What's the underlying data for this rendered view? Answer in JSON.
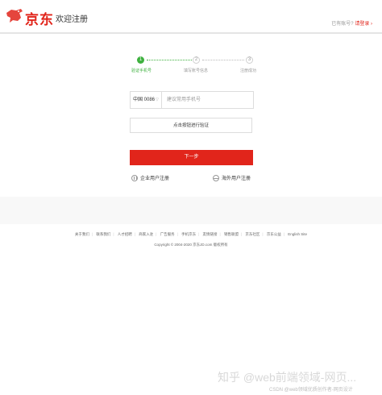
{
  "header": {
    "logo_text": "京东",
    "page_title": "欢迎注册",
    "login_hint": "已有账号?",
    "login_link": "请登录",
    "login_arrow": "›"
  },
  "steps": [
    {
      "number": "1",
      "label": "验证手机号",
      "state": "active"
    },
    {
      "number": "2",
      "label": "填写账号信息",
      "state": "todo"
    },
    {
      "number": "3",
      "label": "注册成功",
      "state": "todo"
    }
  ],
  "form": {
    "country_code": "中国 0086",
    "country_arrow": "▽",
    "phone_placeholder": "建议常用手机号",
    "verify_label": "点击按钮进行验证",
    "next_label": "下一步",
    "enterprise_link": "企业用户注册",
    "overseas_link": "海外用户注册"
  },
  "footer": {
    "links": [
      "关于我们",
      "联系我们",
      "人才招聘",
      "商家入驻",
      "广告服务",
      "手机京东",
      "友情链接",
      "销售联盟",
      "京东社区",
      "京东公益",
      "English Site"
    ],
    "copyright": "Copyright © 2004-2020  京东JD.com 版权所有"
  },
  "watermark": {
    "text": "知乎 @web前端领域-网页...",
    "csdn": "CSDN @web领域优质创作者-网页设计"
  },
  "colors": {
    "brand_red": "#e1251b",
    "step_green": "#3eb13f"
  }
}
